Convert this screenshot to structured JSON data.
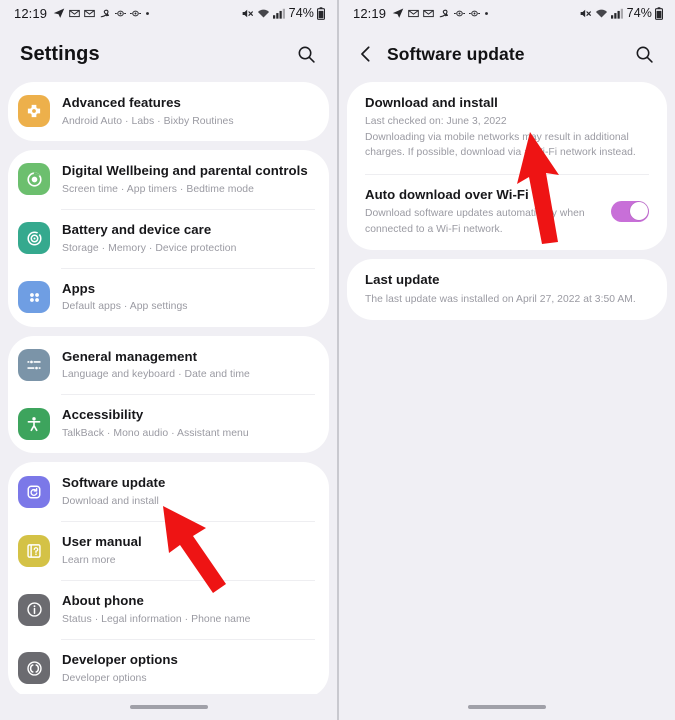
{
  "statusbar": {
    "time": "12:19",
    "left_icons": [
      "telegram-icon",
      "mail-icon",
      "mail-icon",
      "loop-icon",
      "eye-icon",
      "eye-icon",
      "dot-icon"
    ],
    "right_icons": [
      "mute-icon",
      "wifi-icon",
      "signal-icon"
    ],
    "battery": "74%"
  },
  "left_screen": {
    "header": {
      "title": "Settings",
      "search_icon": "search-icon"
    },
    "groups": [
      {
        "items": [
          {
            "title": "Advanced features",
            "subtitle": "Android Auto  ·  Labs  ·  Bixby Routines",
            "icon": "advanced-features-icon",
            "color": "#edb04b"
          }
        ]
      },
      {
        "items": [
          {
            "title": "Digital Wellbeing and parental controls",
            "subtitle": "Screen time  ·  App timers  ·  Bedtime mode",
            "icon": "wellbeing-icon",
            "color": "#6cbf6e"
          },
          {
            "title": "Battery and device care",
            "subtitle": "Storage  ·  Memory  ·  Device protection",
            "icon": "battery-care-icon",
            "color": "#35a98e"
          },
          {
            "title": "Apps",
            "subtitle": "Default apps  ·  App settings",
            "icon": "apps-icon",
            "color": "#6f9ee3"
          }
        ]
      },
      {
        "items": [
          {
            "title": "General management",
            "subtitle": "Language and keyboard  ·  Date and time",
            "icon": "sliders-icon",
            "color": "#7b94a8"
          },
          {
            "title": "Accessibility",
            "subtitle": "TalkBack  ·  Mono audio  ·  Assistant menu",
            "icon": "accessibility-icon",
            "color": "#3da45d"
          }
        ]
      },
      {
        "items": [
          {
            "title": "Software update",
            "subtitle": "Download and install",
            "icon": "software-update-icon",
            "color": "#7b78e8"
          },
          {
            "title": "User manual",
            "subtitle": "Learn more",
            "icon": "user-manual-icon",
            "color": "#d4c246"
          },
          {
            "title": "About phone",
            "subtitle": "Status  ·  Legal information  ·  Phone name",
            "icon": "info-icon",
            "color": "#6b6b70"
          },
          {
            "title": "Developer options",
            "subtitle": "Developer options",
            "icon": "developer-options-icon",
            "color": "#6b6b70"
          }
        ]
      }
    ]
  },
  "right_screen": {
    "header": {
      "back_icon": "chevron-left-icon",
      "title": "Software update",
      "search_icon": "search-icon"
    },
    "cards": [
      {
        "rows": [
          {
            "title": "Download and install",
            "subtitle": "Last checked on: June 3, 2022\nDownloading via mobile networks may result in additional charges. If possible, download via a Wi-Fi network instead.",
            "has_toggle": false
          },
          {
            "title": "Auto download over Wi-Fi",
            "subtitle": "Download software updates automatically when connected to a Wi-Fi network.",
            "has_toggle": true,
            "toggle_on": true,
            "toggle_color": "#c86fd8"
          }
        ]
      },
      {
        "rows": [
          {
            "title": "Last update",
            "subtitle": "The last update was installed on April 27, 2022 at 3:50 AM.",
            "has_toggle": false
          }
        ]
      }
    ]
  },
  "annotations": {
    "arrow_color": "#ee1414",
    "arrows": [
      {
        "name": "arrow-pointing-software-update",
        "target": "Software update"
      },
      {
        "name": "arrow-pointing-download-and-install",
        "target": "Download and install"
      }
    ]
  },
  "navbar": {
    "pill": "home-indicator"
  }
}
